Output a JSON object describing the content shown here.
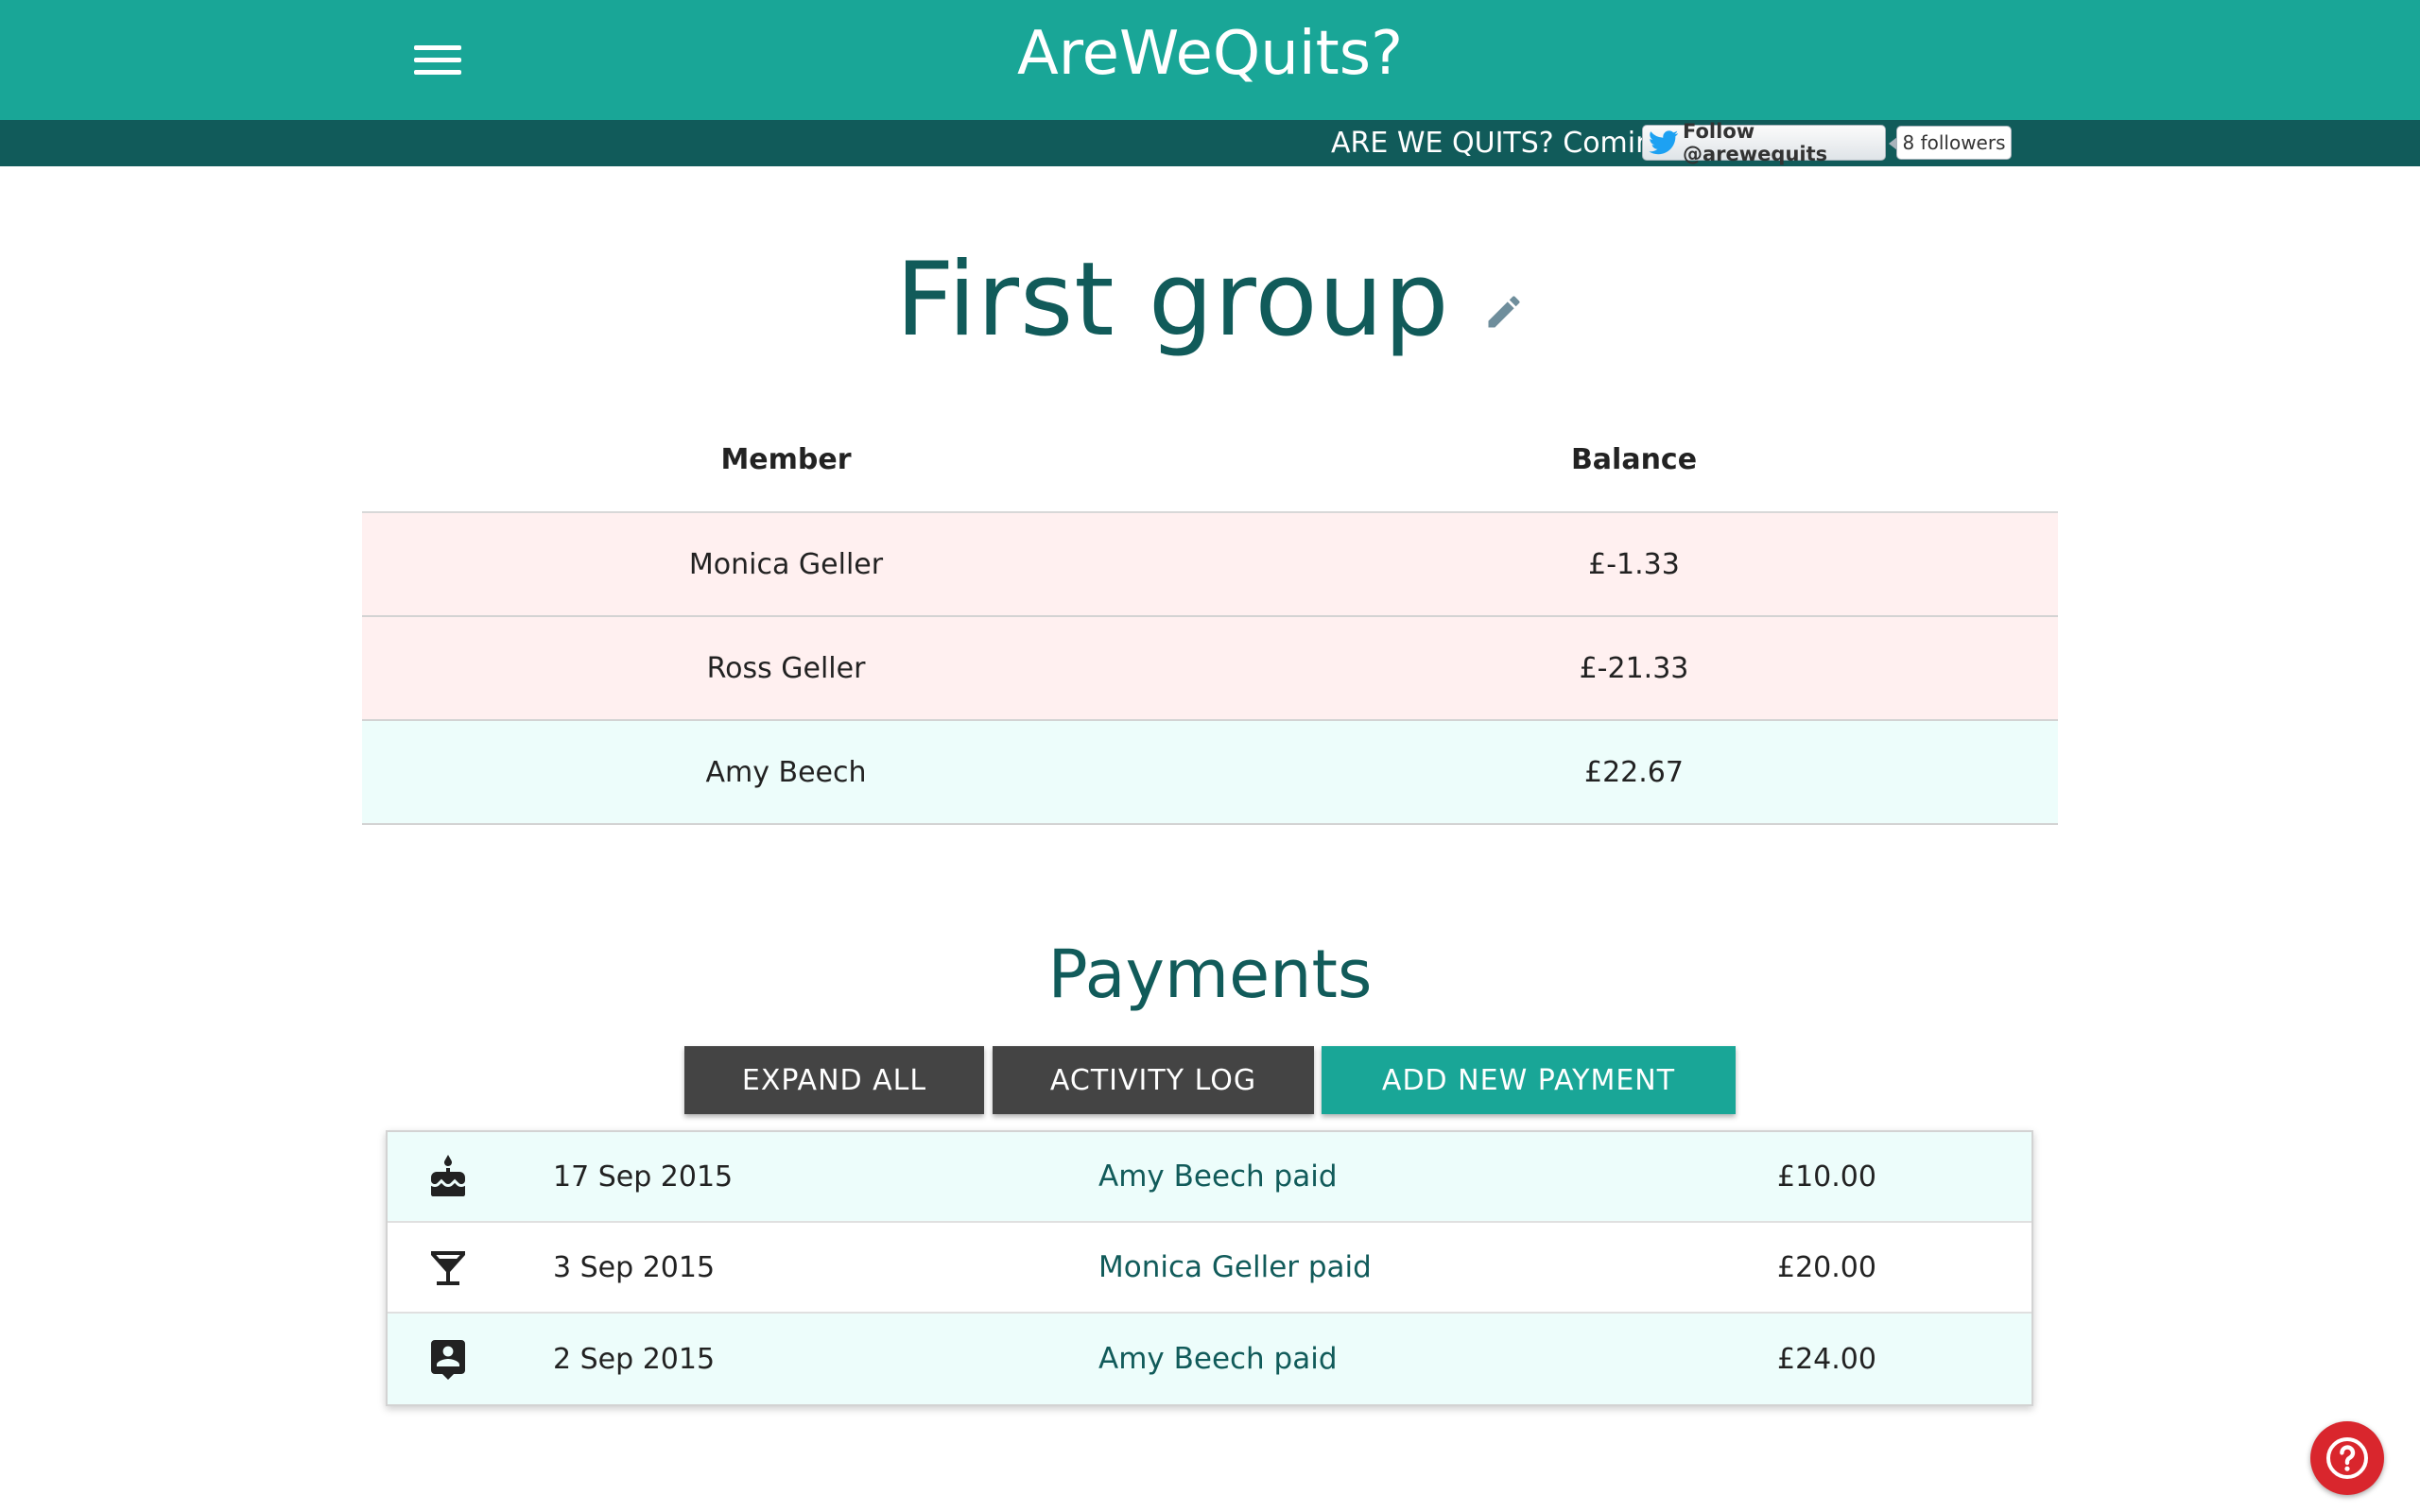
{
  "header": {
    "title": "AreWeQuits?",
    "ticker": "ARE WE QUITS? Coming",
    "twitter_follow": "Follow @arewequits",
    "twitter_followers": "8 followers"
  },
  "group": {
    "name": "First group"
  },
  "members_table": {
    "headers": [
      "Member",
      "Balance"
    ],
    "rows": [
      {
        "member": "Monica Geller",
        "balance": "£-1.33",
        "status": "negative"
      },
      {
        "member": "Ross Geller",
        "balance": "£-21.33",
        "status": "negative"
      },
      {
        "member": "Amy Beech",
        "balance": "£22.67",
        "status": "positive"
      }
    ]
  },
  "payments": {
    "title": "Payments",
    "buttons": {
      "expand_all": "EXPAND ALL",
      "activity_log": "ACTIVITY LOG",
      "add_new": "ADD NEW PAYMENT"
    },
    "items": [
      {
        "icon": "birthday-cake-icon",
        "date": "17 Sep 2015",
        "description": "Amy Beech paid",
        "amount": "£10.00"
      },
      {
        "icon": "cocktail-icon",
        "date": "3 Sep 2015",
        "description": "Monica Geller paid",
        "amount": "£20.00"
      },
      {
        "icon": "contact-card-icon",
        "date": "2 Sep 2015",
        "description": "Amy Beech paid",
        "amount": "£24.00"
      }
    ]
  },
  "colors": {
    "primary": "#19a697",
    "dark_teal": "#115b5a",
    "negative_row": "#fff0f0",
    "positive_row": "#edfdfb",
    "help": "#d9262d"
  }
}
